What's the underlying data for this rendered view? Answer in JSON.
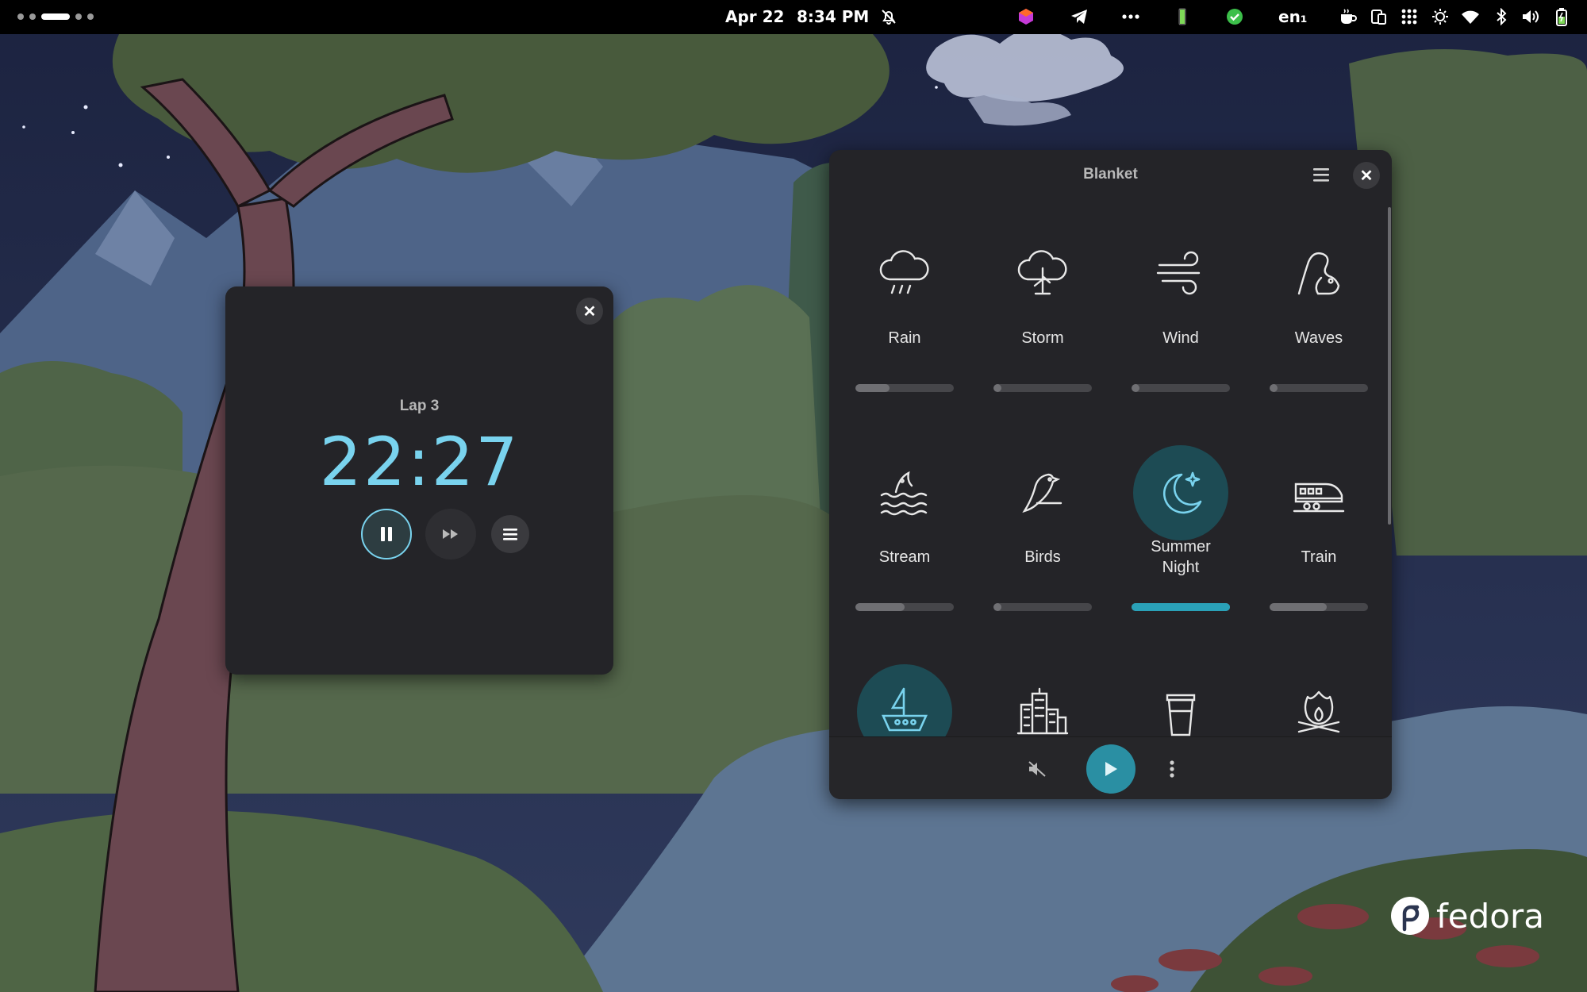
{
  "topbar": {
    "date": "Apr 22",
    "time": "8:34 PM",
    "language": "en₁",
    "workspaces": 5,
    "active_workspace": 3
  },
  "timer_window": {
    "lap_label": "Lap 3",
    "time_display": "22:27",
    "close_icon": "✕"
  },
  "blanket_window": {
    "title": "Blanket",
    "close_icon": "✕",
    "sounds": [
      {
        "label": "Rain",
        "icon": "rain-icon",
        "volume": 0.35,
        "active": false
      },
      {
        "label": "Storm",
        "icon": "storm-icon",
        "volume": 0.08,
        "active": false
      },
      {
        "label": "Wind",
        "icon": "wind-icon",
        "volume": 0.08,
        "active": false
      },
      {
        "label": "Waves",
        "icon": "waves-icon",
        "volume": 0.08,
        "active": false
      },
      {
        "label": "Stream",
        "icon": "stream-icon",
        "volume": 0.5,
        "active": false
      },
      {
        "label": "Birds",
        "icon": "birds-icon",
        "volume": 0.08,
        "active": false
      },
      {
        "label": "Summer Night",
        "icon": "summer-night-icon",
        "volume": 1.0,
        "active": true
      },
      {
        "label": "Train",
        "icon": "train-icon",
        "volume": 0.58,
        "active": false
      },
      {
        "label": "",
        "icon": "boat-icon",
        "volume": 0,
        "active": true
      },
      {
        "label": "",
        "icon": "city-icon",
        "volume": 0,
        "active": false
      },
      {
        "label": "",
        "icon": "coffee-shop-icon",
        "volume": 0,
        "active": false
      },
      {
        "label": "",
        "icon": "fireplace-icon",
        "volume": 0,
        "active": false
      }
    ]
  },
  "branding": {
    "distro": "fedora"
  },
  "colors": {
    "accent": "#79d3ee",
    "active_bg": "#1d4b54",
    "slider_active": "#2aa1b8",
    "play_button": "#2a8fa3"
  }
}
